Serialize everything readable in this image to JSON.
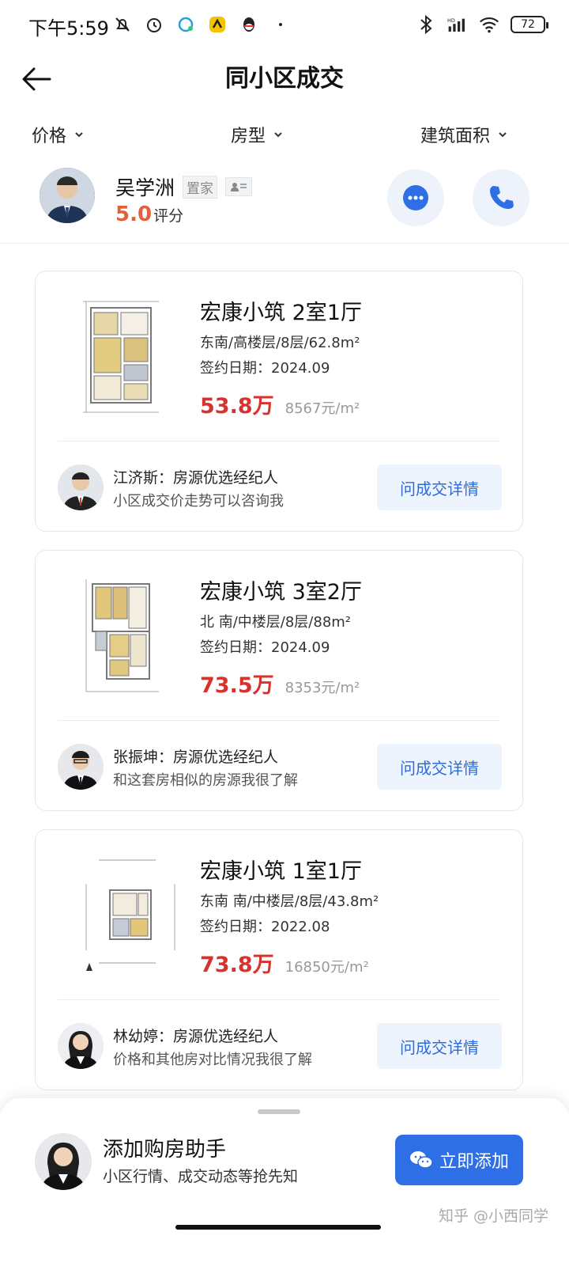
{
  "status_bar": {
    "time": "下午5:59",
    "battery": "72",
    "network": "HD"
  },
  "header": {
    "title": "同小区成交"
  },
  "filters": [
    {
      "label": "价格"
    },
    {
      "label": "房型"
    },
    {
      "label": "建筑面积"
    }
  ],
  "agent": {
    "name": "吴学洲",
    "tag": "置家",
    "score": "5.0",
    "score_label": "评分"
  },
  "listings": [
    {
      "title": "宏康小筑 2室1厅",
      "info": "东南/高楼层/8层/62.8m²",
      "date": "签约日期：2024.09",
      "price": "53.8万",
      "unit_price": "8567元/m²",
      "broker_line1": "江济斯：房源优选经纪人",
      "broker_line2": "小区成交价走势可以咨询我",
      "button": "问成交详情"
    },
    {
      "title": "宏康小筑 3室2厅",
      "info": "北 南/中楼层/8层/88m²",
      "date": "签约日期：2024.09",
      "price": "73.5万",
      "unit_price": "8353元/m²",
      "broker_line1": "张振坤：房源优选经纪人",
      "broker_line2": "和这套房相似的房源我很了解",
      "button": "问成交详情"
    },
    {
      "title": "宏康小筑 1室1厅",
      "info": "东南 南/中楼层/8层/43.8m²",
      "date": "签约日期：2022.08",
      "price": "73.8万",
      "unit_price": "16850元/m²",
      "broker_line1": "林幼婷：房源优选经纪人",
      "broker_line2": "价格和其他房对比情况我很了解",
      "button": "问成交详情"
    }
  ],
  "assistant": {
    "title": "添加购房助手",
    "subtitle": "小区行情、成交动态等抢先知",
    "button": "立即添加"
  },
  "watermark": "知乎 @小西同学",
  "colors": {
    "accent": "#2f6fe6",
    "price": "#d9312b",
    "score": "#e0613a"
  }
}
